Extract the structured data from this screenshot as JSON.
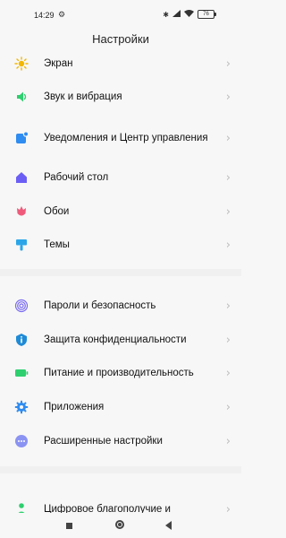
{
  "status_bar": {
    "time": "14:29",
    "icons": [
      "settings-gear-icon",
      "bluetooth-icon",
      "signal-icon",
      "wifi-icon"
    ],
    "battery": "76"
  },
  "title": "Настройки",
  "items": [
    {
      "label": "Экран",
      "icon": "sun-icon",
      "color": "#f2b705"
    },
    {
      "label": "Звук и вибрация",
      "icon": "speaker-icon",
      "color": "#2ecf6e"
    },
    {
      "label": "Уведомления и Центр управления",
      "icon": "notification-icon",
      "color": "#2f8cf0"
    },
    {
      "label": "Рабочий стол",
      "icon": "home-icon",
      "color": "#6b5ef5"
    },
    {
      "label": "Обои",
      "icon": "tulip-icon",
      "color": "#ef5a7b"
    },
    {
      "label": "Темы",
      "icon": "brush-icon",
      "color": "#2aa6e8"
    },
    {
      "label": "Пароли и безопасность",
      "icon": "fingerprint-icon",
      "color": "#7a6cf0"
    },
    {
      "label": "Защита конфиденциальности",
      "icon": "shield-info-icon",
      "color": "#1f8bd6"
    },
    {
      "label": "Питание и производительность",
      "icon": "battery-icon",
      "color": "#2ecf6e"
    },
    {
      "label": "Приложения",
      "icon": "gear-icon",
      "color": "#2f8cf0"
    },
    {
      "label": "Расширенные настройки",
      "icon": "more-dots-icon",
      "color": "#8b93f2"
    },
    {
      "label": "Цифровое благополучие и",
      "icon": "wellbeing-icon",
      "color": "#2ecf6e"
    }
  ],
  "nav_bar": {
    "buttons": [
      "recents-icon",
      "home-icon",
      "back-icon"
    ]
  }
}
